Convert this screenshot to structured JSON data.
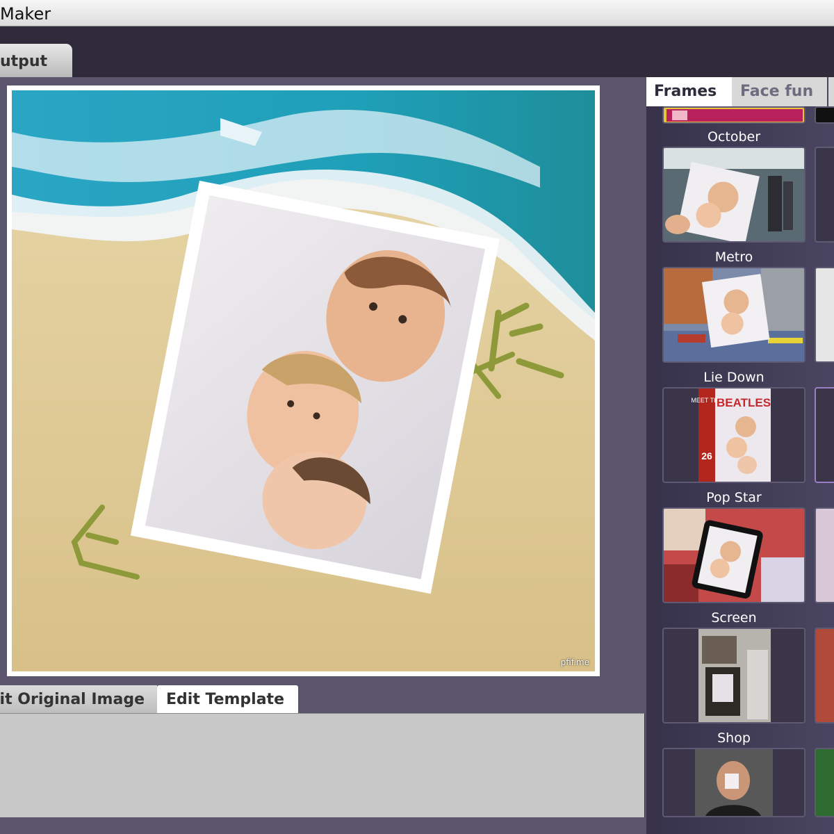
{
  "window": {
    "title": "Maker"
  },
  "top_tabs": {
    "output": "utput"
  },
  "canvas": {
    "watermark": "pfif.me"
  },
  "bottom_tabs": {
    "original": "Edit Original Image",
    "edit": "Edit Template"
  },
  "right_tabs": {
    "frames": "Frames",
    "face_fun": "Face fun"
  },
  "templates": [
    {
      "label": "October"
    },
    {
      "label": "Metro"
    },
    {
      "label": "Lie Down"
    },
    {
      "label": "Pop Star"
    },
    {
      "label": "Screen"
    },
    {
      "label": "Shop"
    }
  ],
  "poster_text": {
    "meet": "MEET THE",
    "band": "BEATLES",
    "number": "26"
  }
}
